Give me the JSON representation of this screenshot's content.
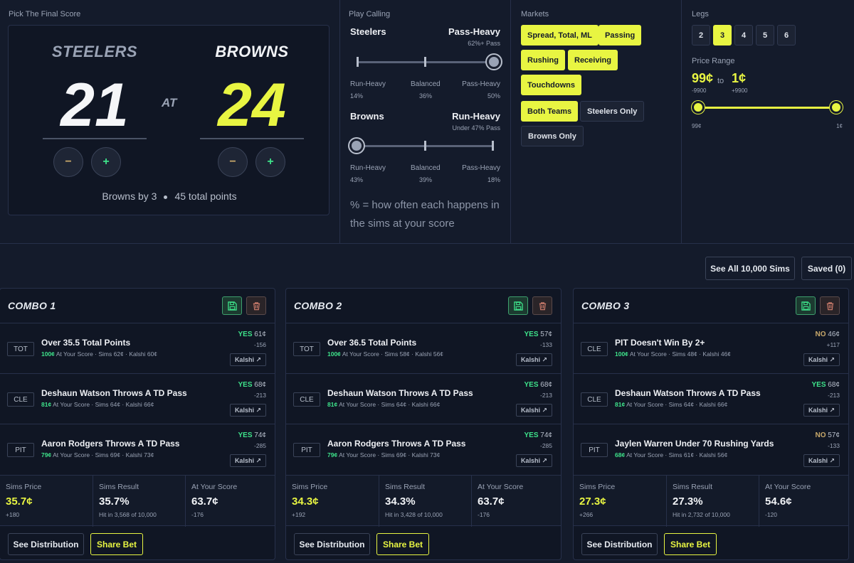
{
  "score_panel": {
    "title": "Pick The Final Score",
    "home_team": "STEELERS",
    "away_team": "BROWNS",
    "home_score": "21",
    "away_score": "24",
    "at_label": "AT",
    "minus_glyph": "−",
    "plus_glyph": "+",
    "summary_margin": "Browns by 3",
    "summary_total": "45 total points"
  },
  "play_calling": {
    "title": "Play Calling",
    "teams": [
      {
        "name": "Steelers",
        "mode": "Pass-Heavy",
        "mode_sub": "62%+ Pass",
        "level": 1.0,
        "labels": [
          {
            "name": "Run-Heavy",
            "pct": "14%"
          },
          {
            "name": "Balanced",
            "pct": "36%"
          },
          {
            "name": "Pass-Heavy",
            "pct": "50%"
          }
        ]
      },
      {
        "name": "Browns",
        "mode": "Run-Heavy",
        "mode_sub": "Under 47% Pass",
        "level": 0.0,
        "labels": [
          {
            "name": "Run-Heavy",
            "pct": "43%"
          },
          {
            "name": "Balanced",
            "pct": "39%"
          },
          {
            "name": "Pass-Heavy",
            "pct": "18%"
          }
        ]
      }
    ],
    "legend": "% = how often each happens in the sims at your score"
  },
  "markets": {
    "title": "Markets",
    "items": [
      {
        "label": "Spread, Total, ML",
        "selected": true
      },
      {
        "label": "Passing",
        "selected": true
      },
      {
        "label": "Rushing",
        "selected": true
      },
      {
        "label": "Receiving",
        "selected": true
      },
      {
        "label": "Touchdowns",
        "selected": true
      },
      {
        "label": "Both Teams",
        "selected": true
      },
      {
        "label": "Steelers Only",
        "selected": false
      },
      {
        "label": "Browns Only",
        "selected": false
      }
    ]
  },
  "legs": {
    "title": "Legs",
    "options": [
      "2",
      "3",
      "4",
      "5",
      "6"
    ],
    "selected": "3"
  },
  "price_range": {
    "title": "Price Range",
    "min": "99¢",
    "min_odds": "-9900",
    "to": "to",
    "max": "1¢",
    "max_odds": "+9900",
    "end_left": "99¢",
    "end_right": "1¢"
  },
  "actions": {
    "see_all": "See All 10,000 Sims",
    "saved": "Saved (0)"
  },
  "combos": [
    {
      "title": "COMBO 1",
      "legs": [
        {
          "tag": "TOT",
          "title": "Over 35.5 Total Points",
          "pct": "100¢",
          "sub": "At Your Score · Sims 62¢ · Kalshi 60¢",
          "side": "YES",
          "price": "61¢",
          "odds": "-156",
          "kalshi": "Kalshi ↗"
        },
        {
          "tag": "CLE",
          "title": "Deshaun Watson Throws A TD Pass",
          "pct": "81¢",
          "sub": "At Your Score · Sims 64¢ · Kalshi 66¢",
          "side": "YES",
          "price": "68¢",
          "odds": "-213",
          "kalshi": "Kalshi ↗"
        },
        {
          "tag": "PIT",
          "title": "Aaron Rodgers Throws A TD Pass",
          "pct": "79¢",
          "sub": "At Your Score · Sims 69¢ · Kalshi 73¢",
          "side": "YES",
          "price": "74¢",
          "odds": "-285",
          "kalshi": "Kalshi ↗"
        }
      ],
      "stats": [
        {
          "label": "Sims Price",
          "value": "35.7¢",
          "sub": "+180",
          "yellow": true
        },
        {
          "label": "Sims Result",
          "value": "35.7%",
          "sub": "Hit in 3,568 of 10,000",
          "yellow": false
        },
        {
          "label": "At Your Score",
          "value": "63.7¢",
          "sub": "-176",
          "yellow": false
        }
      ],
      "dist": "See Distribution",
      "share": "Share Bet"
    },
    {
      "title": "COMBO 2",
      "legs": [
        {
          "tag": "TOT",
          "title": "Over 36.5 Total Points",
          "pct": "100¢",
          "sub": "At Your Score · Sims 58¢ · Kalshi 56¢",
          "side": "YES",
          "price": "57¢",
          "odds": "-133",
          "kalshi": "Kalshi ↗"
        },
        {
          "tag": "CLE",
          "title": "Deshaun Watson Throws A TD Pass",
          "pct": "81¢",
          "sub": "At Your Score · Sims 64¢ · Kalshi 66¢",
          "side": "YES",
          "price": "68¢",
          "odds": "-213",
          "kalshi": "Kalshi ↗"
        },
        {
          "tag": "PIT",
          "title": "Aaron Rodgers Throws A TD Pass",
          "pct": "79¢",
          "sub": "At Your Score · Sims 69¢ · Kalshi 73¢",
          "side": "YES",
          "price": "74¢",
          "odds": "-285",
          "kalshi": "Kalshi ↗"
        }
      ],
      "stats": [
        {
          "label": "Sims Price",
          "value": "34.3¢",
          "sub": "+192",
          "yellow": true
        },
        {
          "label": "Sims Result",
          "value": "34.3%",
          "sub": "Hit in 3,428 of 10,000",
          "yellow": false
        },
        {
          "label": "At Your Score",
          "value": "63.7¢",
          "sub": "-176",
          "yellow": false
        }
      ],
      "dist": "See Distribution",
      "share": "Share Bet"
    },
    {
      "title": "COMBO 3",
      "legs": [
        {
          "tag": "CLE",
          "title": "PIT Doesn't Win By 2+",
          "pct": "100¢",
          "sub": "At Your Score · Sims 48¢ · Kalshi 46¢",
          "side": "NO",
          "price": "46¢",
          "odds": "+117",
          "kalshi": "Kalshi ↗"
        },
        {
          "tag": "CLE",
          "title": "Deshaun Watson Throws A TD Pass",
          "pct": "81¢",
          "sub": "At Your Score · Sims 64¢ · Kalshi 66¢",
          "side": "YES",
          "price": "68¢",
          "odds": "-213",
          "kalshi": "Kalshi ↗"
        },
        {
          "tag": "PIT",
          "title": "Jaylen Warren Under 70 Rushing Yards",
          "pct": "68¢",
          "sub": "At Your Score · Sims 61¢ · Kalshi 56¢",
          "side": "NO",
          "price": "57¢",
          "odds": "-133",
          "kalshi": "Kalshi ↗"
        }
      ],
      "stats": [
        {
          "label": "Sims Price",
          "value": "27.3¢",
          "sub": "+266",
          "yellow": true
        },
        {
          "label": "Sims Result",
          "value": "27.3%",
          "sub": "Hit in 2,732 of 10,000",
          "yellow": false
        },
        {
          "label": "At Your Score",
          "value": "54.6¢",
          "sub": "-120",
          "yellow": false
        }
      ],
      "dist": "See Distribution",
      "share": "Share Bet"
    }
  ],
  "colors": {
    "accent": "#e8f542",
    "yes": "#3ee28a",
    "no": "#c8a86a",
    "background": "#141b2b"
  }
}
